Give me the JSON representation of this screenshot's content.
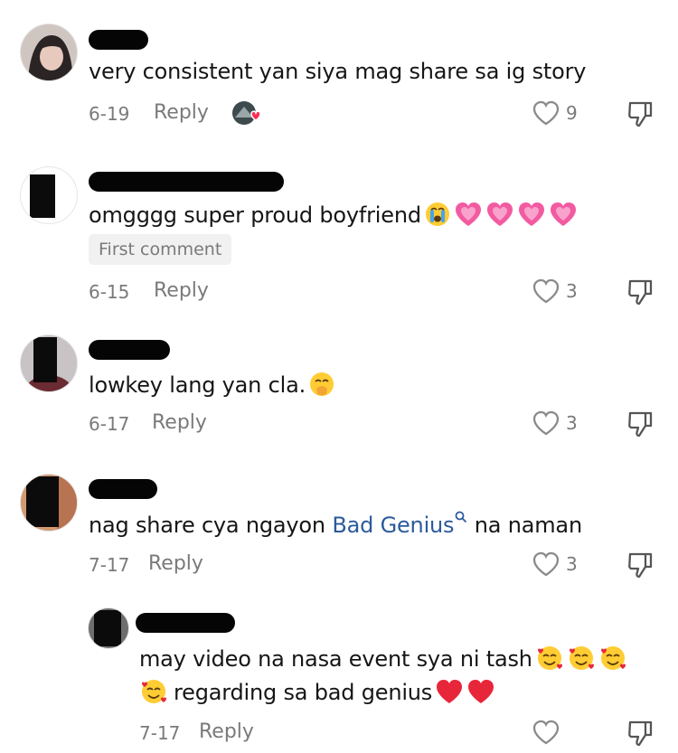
{
  "comments": [
    {
      "text": "very consistent yan siya mag share sa ig story",
      "date": "6-19",
      "reply_label": "Reply",
      "likes": "9",
      "reacted_avatar": "creator-liked-avatar"
    },
    {
      "text": "omgggg super proud boyfriend",
      "badge": "First comment",
      "date": "6-15",
      "reply_label": "Reply",
      "likes": "3"
    },
    {
      "text": "lowkey lang yan cla.",
      "date": "6-17",
      "reply_label": "Reply",
      "likes": "3"
    },
    {
      "text_before": "nag share cya ngayon ",
      "link": "Bad Genius",
      "text_after": " na naman",
      "date": "7-17",
      "reply_label": "Reply",
      "likes": "3"
    },
    {
      "line1": "may video na nasa event sya ni tash",
      "line2": "regarding sa bad genius",
      "date": "7-17",
      "reply_label": "Reply",
      "likes": ""
    }
  ],
  "icons": {
    "like": "heart-outline-icon",
    "dislike": "thumbs-down-icon",
    "search": "search-icon",
    "crying_emoji": "loudly-crying-face-emoji",
    "pink_heart": "growing-heart-emoji",
    "shush_emoji": "face-with-hand-over-mouth-emoji",
    "love_face": "smiling-face-with-hearts-emoji",
    "red_heart": "red-heart-emoji"
  },
  "colors": {
    "link": "#2b5a9c",
    "muted": "#7a7a7a",
    "badge_bg": "#f1f1f2"
  }
}
